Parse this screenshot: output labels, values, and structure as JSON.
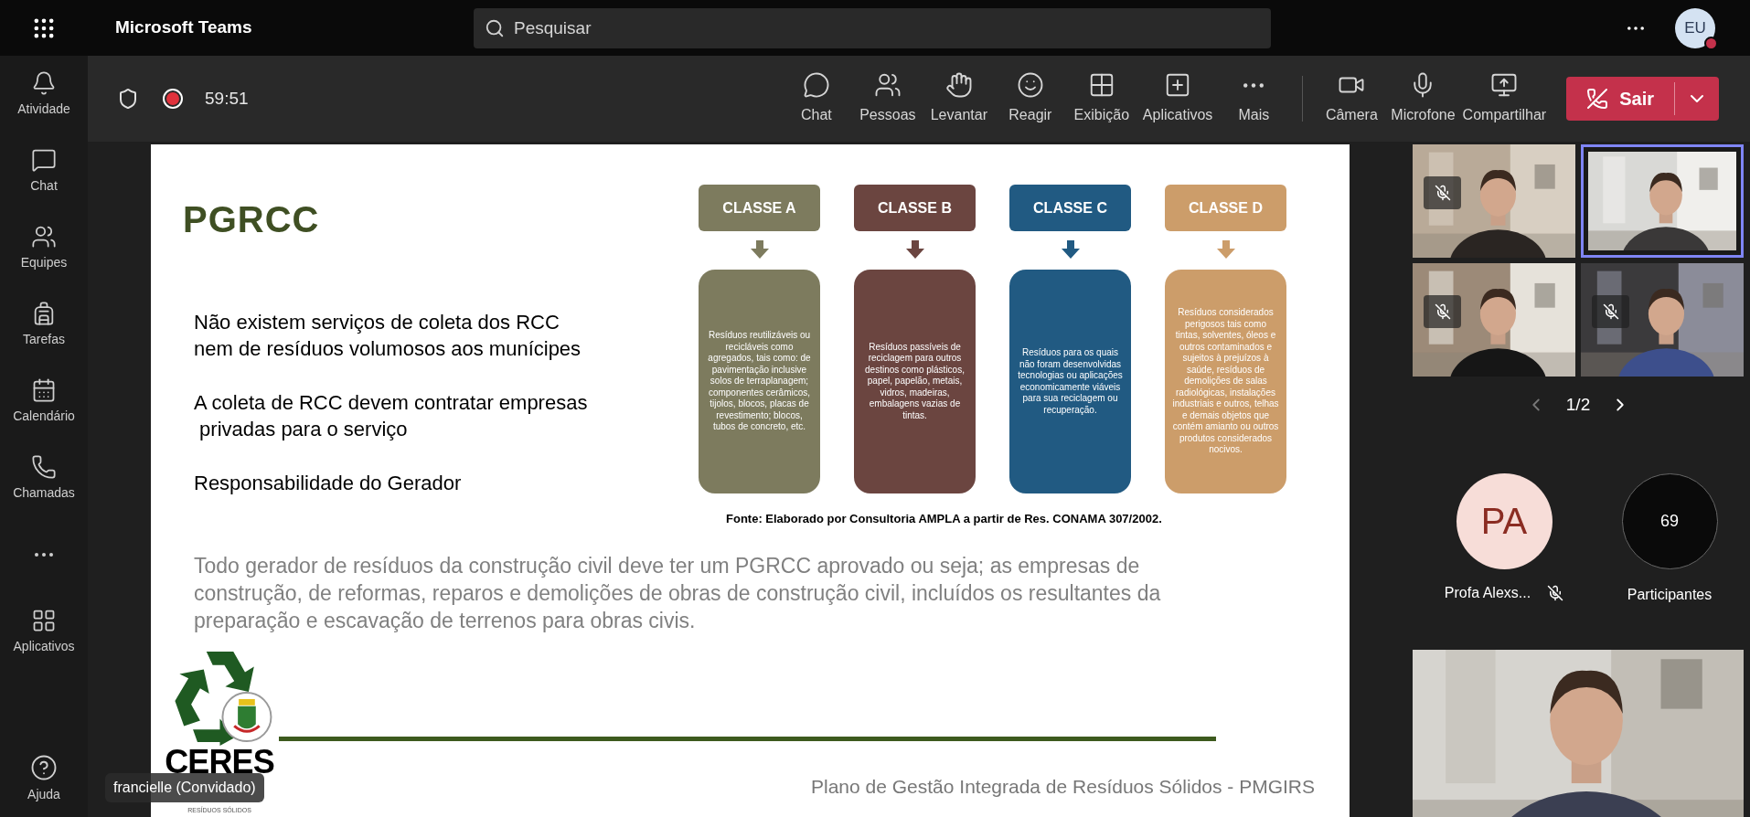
{
  "app": {
    "title": "Microsoft Teams"
  },
  "search": {
    "placeholder": "Pesquisar"
  },
  "user": {
    "initials": "EU"
  },
  "rail": [
    {
      "kind": "bell",
      "label": "Atividade"
    },
    {
      "kind": "chat",
      "label": "Chat"
    },
    {
      "kind": "teams",
      "label": "Equipes"
    },
    {
      "kind": "bag",
      "label": "Tarefas"
    },
    {
      "kind": "calendar",
      "label": "Calendário"
    },
    {
      "kind": "phone",
      "label": "Chamadas"
    },
    {
      "kind": "more"
    },
    {
      "kind": "apps",
      "label": "Aplicativos"
    }
  ],
  "help": {
    "label": "Ajuda"
  },
  "meeting": {
    "timer": "59:51",
    "recording": true
  },
  "toolbar": [
    {
      "kind": "chat",
      "label": "Chat"
    },
    {
      "kind": "people",
      "label": "Pessoas"
    },
    {
      "kind": "hand",
      "label": "Levantar"
    },
    {
      "kind": "smile",
      "label": "Reagir"
    },
    {
      "kind": "view",
      "label": "Exibição"
    },
    {
      "kind": "apps",
      "label": "Aplicativos"
    },
    {
      "kind": "more",
      "label": "Mais"
    }
  ],
  "devices": [
    {
      "kind": "camera",
      "label": "Câmera"
    },
    {
      "kind": "mic",
      "label": "Microfone"
    },
    {
      "kind": "share",
      "label": "Compartilhar"
    }
  ],
  "leave": {
    "label": "Sair"
  },
  "slide": {
    "title": "PGRCC",
    "bullets": [
      [
        "Não existem serviços de coleta dos RCC",
        "nem de resíduos volumosos aos munícipes"
      ],
      [
        "A coleta de RCC devem contratar empresas",
        " privadas para o serviço"
      ],
      [
        "Responsabilidade do Gerador"
      ]
    ],
    "classes": [
      {
        "name": "CLASSE A",
        "color": "#7d7b5e",
        "text": "Resíduos reutilizáveis ou recicláveis como agregados, tais como: de pavimentação inclusive solos de terraplanagem; componentes cerâmicos, tijolos, blocos, placas de revestimento; blocos, tubos de concreto, etc."
      },
      {
        "name": "CLASSE B",
        "color": "#6b4540",
        "text": "Resíduos passíveis de reciclagem para outros destinos como plásticos, papel, papelão, metais, vidros, madeiras, embalagens vazias de tintas."
      },
      {
        "name": "CLASSE C",
        "color": "#215a82",
        "text": "Resíduos para os quais não foram desenvolvidas tecnologias ou aplicações economicamente viáveis para sua reciclagem ou recuperação."
      },
      {
        "name": "CLASSE D",
        "color": "#cc9d6a",
        "text": "Resíduos considerados perigosos tais como tintas, solventes, óleos e outros contaminados e sujeitos à prejuízos à saúde, resíduos de demolições de salas radiológicas, instalações industriais e outros, telhas e demais objetos que contém amianto ou outros produtos considerados nocivos."
      }
    ],
    "source": "Fonte: Elaborado por Consultoria AMPLA a partir de Res. CONAMA 307/2002.",
    "paragraph": "Todo gerador de resíduos da construção civil deve ter um PGRCC aprovado ou seja; as empresas de construção, de reformas, reparos e demolições de obras de construção civil, incluídos os resultantes da preparação e escavação de terrenos para obras civis.",
    "logo": {
      "name": "CERES",
      "subtitle": "RESÍDUOS SÓLIDOS"
    },
    "footer": "Plano de Gestão Integrada de Resíduos Sólidos - PMGIRS"
  },
  "presenter": "francielle (Convidado)",
  "tiles": [
    {
      "muted": true,
      "speaking": false
    },
    {
      "muted": false,
      "speaking": true
    },
    {
      "muted": true,
      "speaking": false
    },
    {
      "muted": true,
      "speaking": false
    }
  ],
  "pager": "1/2",
  "overflow": {
    "initials": "PA",
    "name": "Profa Alexs...",
    "muted": true
  },
  "participants": {
    "count": "69",
    "label": "Participantes"
  }
}
